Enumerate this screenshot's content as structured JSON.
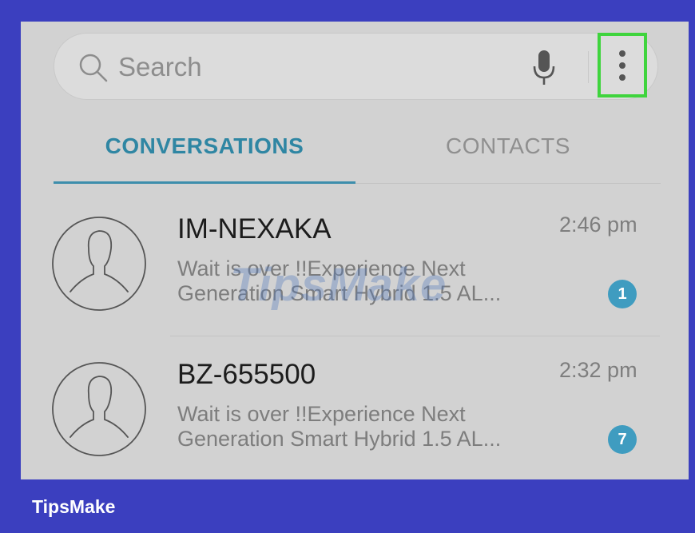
{
  "search": {
    "placeholder": "Search"
  },
  "tabs": [
    {
      "label": "CONVERSATIONS",
      "active": true
    },
    {
      "label": "CONTACTS",
      "active": false
    }
  ],
  "conversations": [
    {
      "sender": "IM-NEXAKA",
      "time": "2:46 pm",
      "preview_line1": "Wait is over !!Experience Next",
      "preview_line2": "Generation Smart Hybrid 1.5 AL...",
      "unread": "1"
    },
    {
      "sender": "BZ-655500",
      "time": "2:32 pm",
      "preview_line1": "Wait is over !!Experience Next",
      "preview_line2": "Generation Smart Hybrid 1.5 AL...",
      "unread": "7"
    }
  ],
  "watermark": "TipsMake",
  "brand": "TipsMake",
  "colors": {
    "frame": "#3b3fbf",
    "highlight": "#3fd43d",
    "accent": "#2f86a3",
    "badge": "#3f9cc0"
  },
  "icons": {
    "search": "search-icon",
    "mic": "mic-icon",
    "more": "more-vertical-icon",
    "avatar": "person-avatar-icon"
  }
}
